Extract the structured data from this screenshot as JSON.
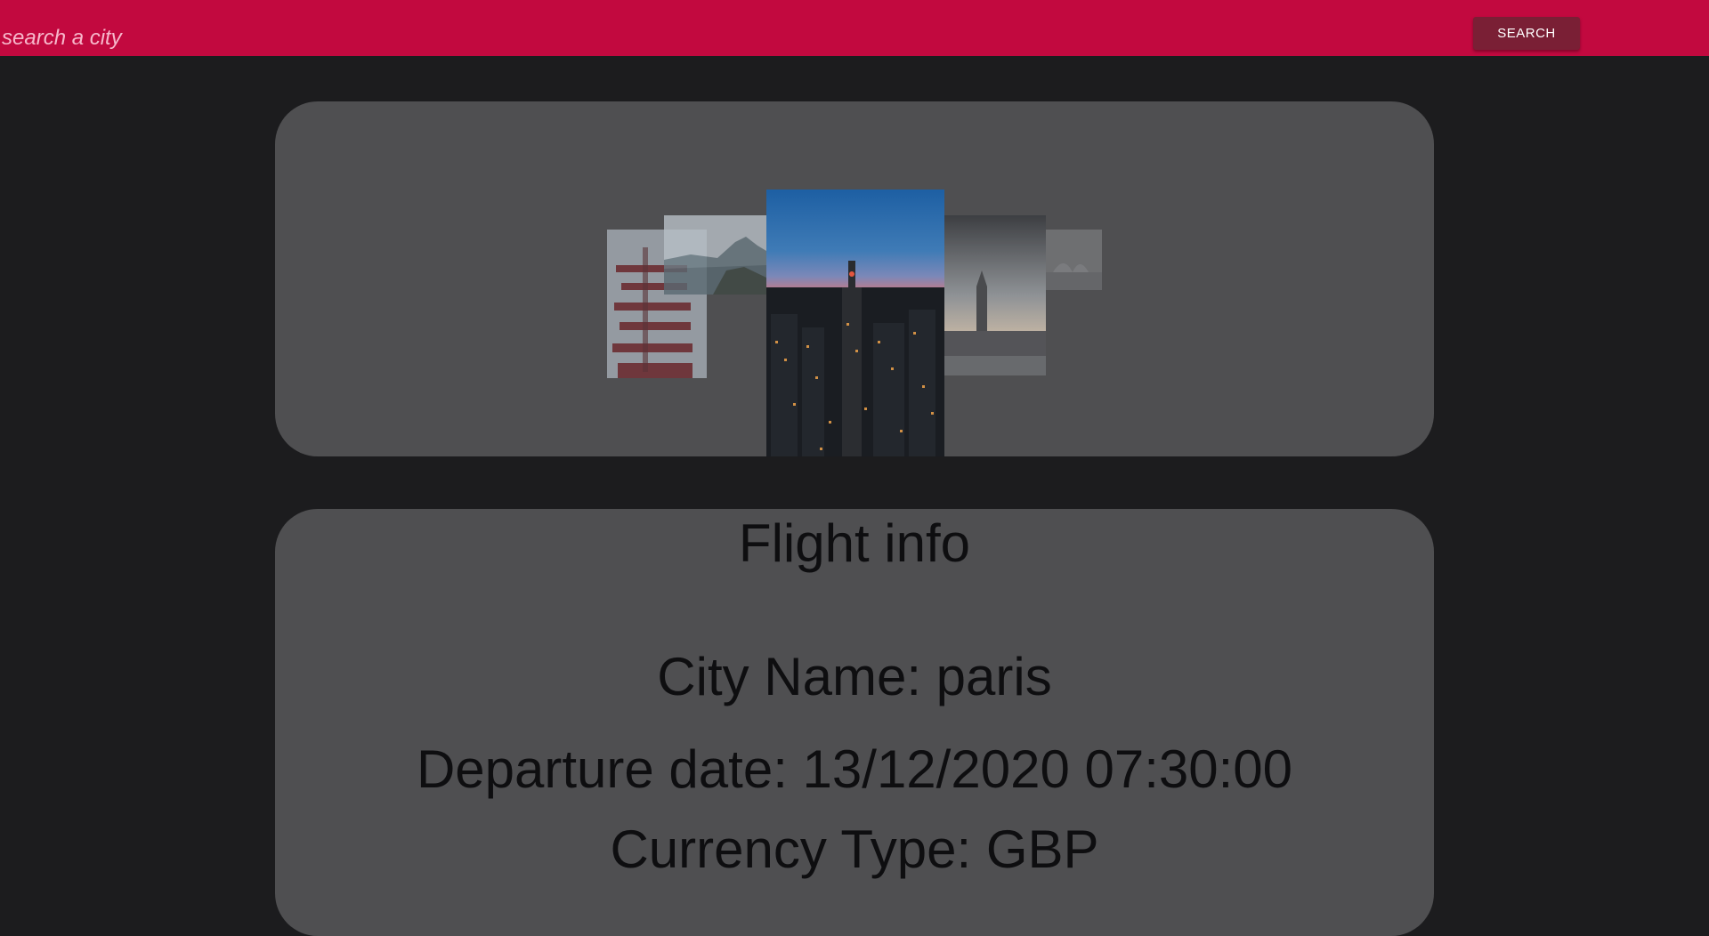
{
  "header": {
    "search_placeholder": "search a city",
    "search_button_label": "SEARCH"
  },
  "colors": {
    "header_bg": "#c2093f",
    "button_bg": "#7a1f35",
    "page_bg": "#1c1c1e",
    "card_bg": "#4f4f51"
  },
  "gallery": {
    "slides": [
      {
        "subject": "pagoda"
      },
      {
        "subject": "mountain-coast"
      },
      {
        "subject": "new-york-skyline-night"
      },
      {
        "subject": "big-ben-london"
      },
      {
        "subject": "sydney-opera-house"
      }
    ]
  },
  "flight_info": {
    "title": "Flight info",
    "city_line": "City Name: paris",
    "departure_line": "Departure date: 13/12/2020 07:30:00",
    "currency_line": "Currency Type: GBP"
  }
}
